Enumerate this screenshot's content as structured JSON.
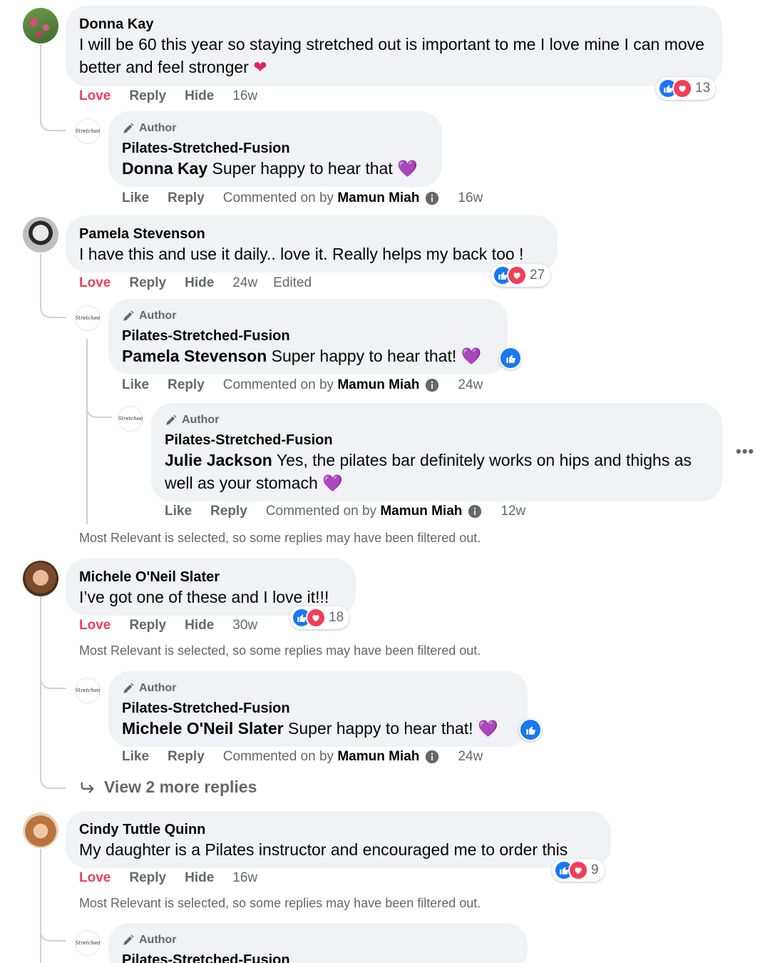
{
  "labels": {
    "love": "Love",
    "like": "Like",
    "reply": "Reply",
    "hide": "Hide",
    "author": "Author",
    "commented_on_by": "Commented on by",
    "edited": "Edited",
    "filter_note": "Most Relevant is selected, so some replies may have been filtered out.",
    "view_more": "View 2 more replies",
    "page_name": "Pilates-Stretched-Fusion",
    "admin_name": "Mamun Miah",
    "logo_text": "Stretched"
  },
  "comments": [
    {
      "name": "Donna Kay",
      "text": "I will be 60 this year so staying stretched out is important to me I love mine I can move better and feel stronger",
      "emoji": "❤️",
      "time": "16w",
      "reactions": "13",
      "reply": {
        "mention": "Donna Kay",
        "text": "Super happy to hear that",
        "emoji": "💜",
        "time": "16w"
      }
    },
    {
      "name": "Pamela Stevenson",
      "text": "I have this and use it daily.. love it. Really helps my back too !",
      "time": "24w",
      "reactions": "27",
      "reply": {
        "mention": "Pamela Stevenson",
        "text": "Super happy to hear that!",
        "emoji": "💜",
        "time": "24w"
      },
      "nested": {
        "mention": "Julie Jackson",
        "text": "Yes, the pilates bar definitely works on hips and thighs as well as your stomach",
        "emoji": "💜",
        "time": "12w"
      }
    },
    {
      "name": "Michele O'Neil Slater",
      "text": "I’ve got one of these and I love it!!!",
      "time": "30w",
      "reactions": "18",
      "reply": {
        "mention": "Michele O'Neil Slater",
        "text": "Super happy to hear that!",
        "emoji": "💜",
        "time": "24w"
      }
    },
    {
      "name": "Cindy Tuttle Quinn",
      "text": "My daughter is a Pilates instructor and encouraged me to order this",
      "time": "16w",
      "reactions": "9"
    }
  ],
  "icons": {
    "like": "thumbs-up-icon",
    "heart": "heart-icon",
    "pencil": "pencil-icon",
    "info": "info-icon",
    "more": "more-options-icon",
    "reply_arrow": "reply-arrow-icon"
  },
  "colors": {
    "like_blue": "#1877f2",
    "love_red": "#f33e58",
    "bubble_bg": "#f0f2f5",
    "muted_text": "#65676b",
    "purple_heart": "#8e44d8"
  }
}
